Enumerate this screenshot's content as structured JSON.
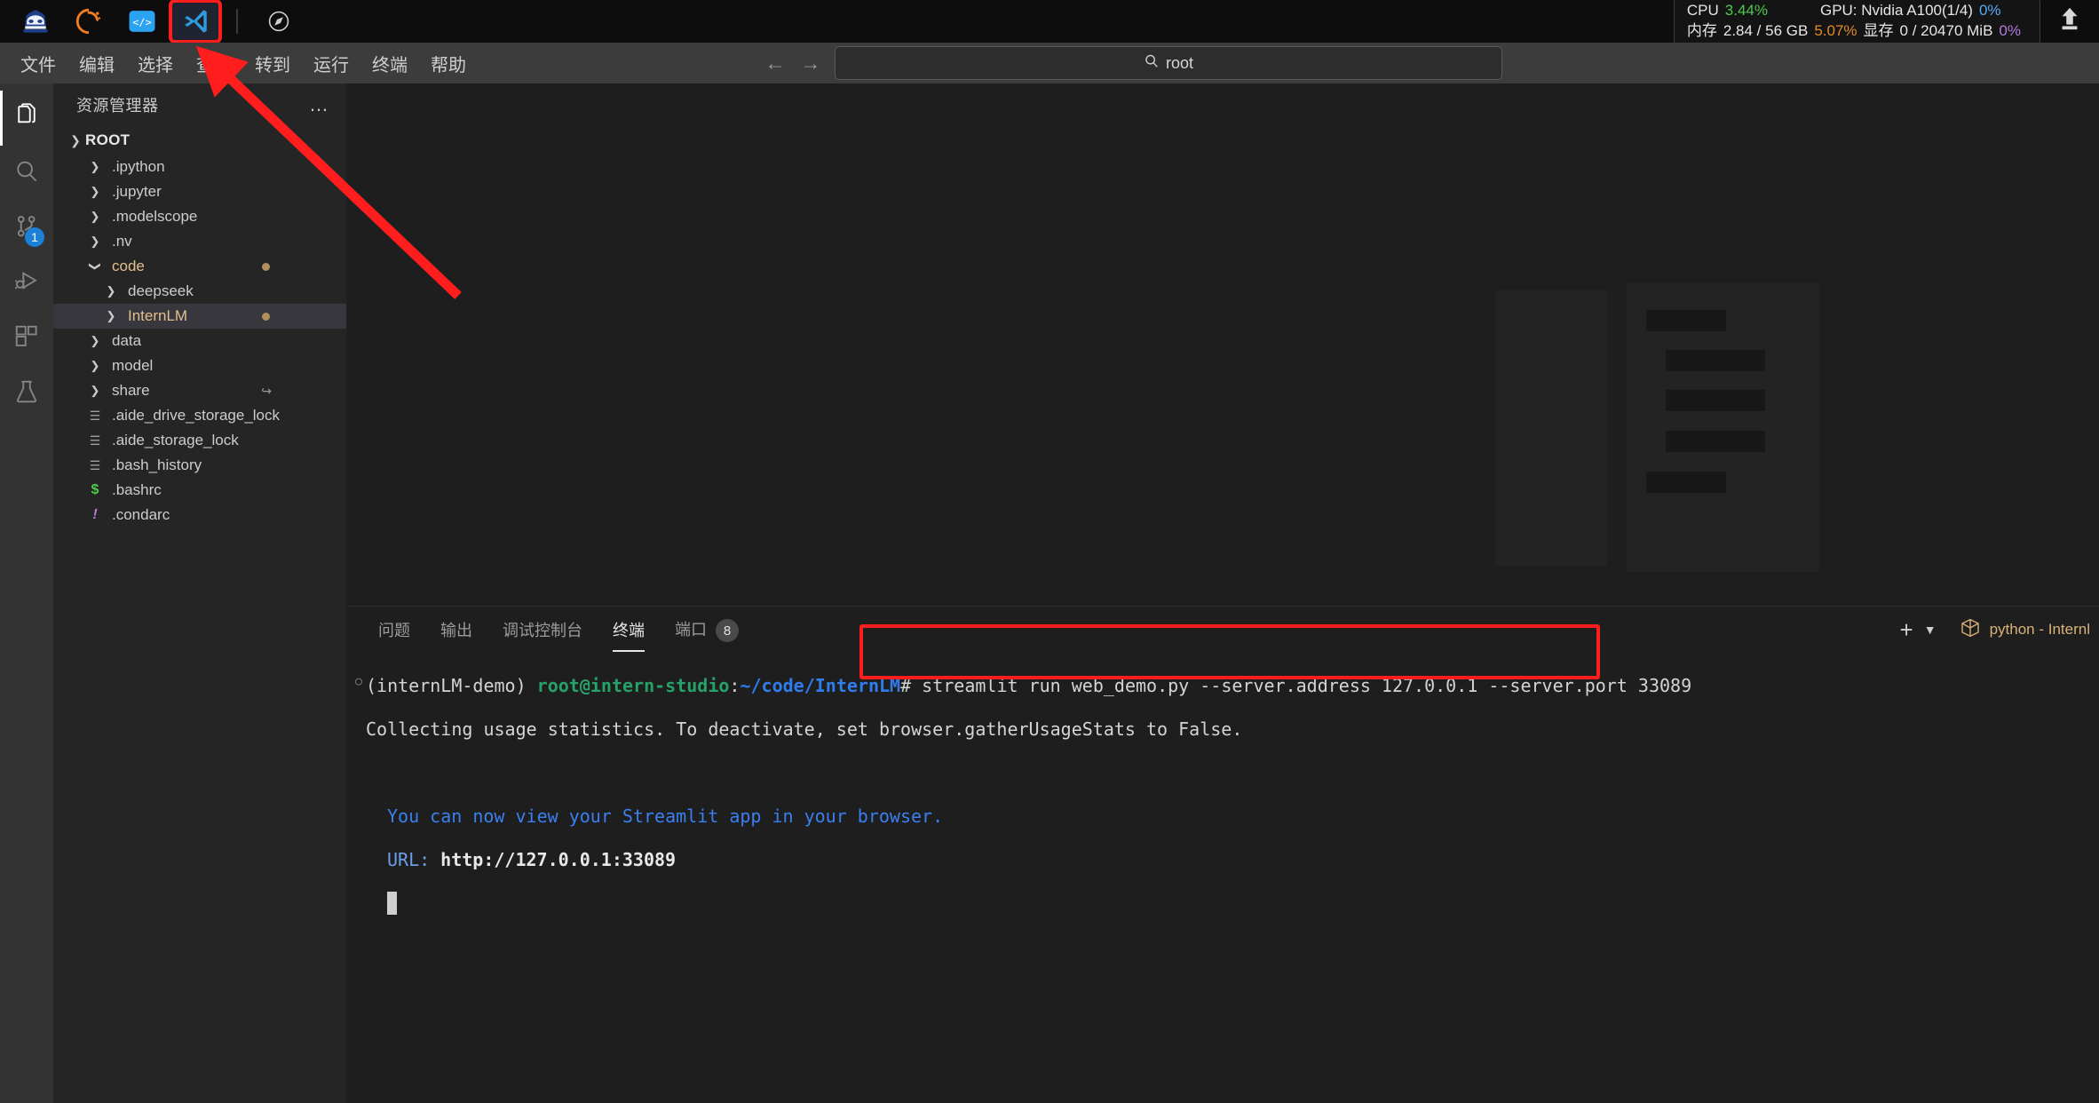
{
  "os_bar": {
    "icons": [
      {
        "name": "intern-studio-logo",
        "glyph": "mascot"
      },
      {
        "name": "conda-logo",
        "glyph": "conda"
      },
      {
        "name": "code-server-icon",
        "glyph": "<l>"
      },
      {
        "name": "vscode-icon",
        "glyph": "vscode",
        "highlighted": true
      },
      {
        "name": "compass-icon",
        "glyph": "compass"
      }
    ],
    "stats": {
      "cpu_label": "CPU",
      "cpu_value": "3.44%",
      "gpu_label": "GPU: Nvidia A100(1/4)",
      "gpu_value": "0%",
      "mem_label": "内存",
      "mem_value": "2.84 / 56 GB",
      "mem_percent": "5.07%",
      "vram_label": "显存",
      "vram_value": "0 / 20470 MiB",
      "vram_percent": "0%"
    },
    "upload_icon": "upload-icon"
  },
  "menubar": {
    "items": [
      "文件",
      "编辑",
      "选择",
      "查看",
      "转到",
      "运行",
      "终端",
      "帮助"
    ]
  },
  "search": {
    "back_icon": "←",
    "forward_icon": "→",
    "search_icon": "search-icon",
    "value": "root"
  },
  "activity_bar": {
    "items": [
      {
        "name": "explorer",
        "icon": "files-icon",
        "active": true,
        "badge": ""
      },
      {
        "name": "search",
        "icon": "search-icon",
        "active": false,
        "badge": ""
      },
      {
        "name": "source-control",
        "icon": "source-control-icon",
        "active": false,
        "badge": "1"
      },
      {
        "name": "run-and-debug",
        "icon": "run-debug-icon",
        "active": false,
        "badge": ""
      },
      {
        "name": "extensions",
        "icon": "extensions-icon",
        "active": false,
        "badge": ""
      },
      {
        "name": "testing",
        "icon": "beaker-icon",
        "active": false,
        "badge": ""
      }
    ]
  },
  "explorer": {
    "title": "资源管理器",
    "more_icon": "ellipsis-icon",
    "root_label": "ROOT",
    "tree": [
      {
        "label": ".ipython",
        "type": "folder",
        "depth": 1,
        "expanded": false,
        "selected": false,
        "modified": false
      },
      {
        "label": ".jupyter",
        "type": "folder",
        "depth": 1,
        "expanded": false,
        "selected": false,
        "modified": false
      },
      {
        "label": ".modelscope",
        "type": "folder",
        "depth": 1,
        "expanded": false,
        "selected": false,
        "modified": false
      },
      {
        "label": ".nv",
        "type": "folder",
        "depth": 1,
        "expanded": false,
        "selected": false,
        "modified": false
      },
      {
        "label": "code",
        "type": "folder",
        "depth": 1,
        "expanded": true,
        "selected": false,
        "modified": true
      },
      {
        "label": "deepseek",
        "type": "folder",
        "depth": 2,
        "expanded": false,
        "selected": false,
        "modified": false
      },
      {
        "label": "InternLM",
        "type": "folder",
        "depth": 2,
        "expanded": false,
        "selected": true,
        "modified": true
      },
      {
        "label": "data",
        "type": "folder",
        "depth": 1,
        "expanded": false,
        "selected": false,
        "modified": false
      },
      {
        "label": "model",
        "type": "folder",
        "depth": 1,
        "expanded": false,
        "selected": false,
        "modified": false
      },
      {
        "label": "share",
        "type": "folder",
        "depth": 1,
        "expanded": false,
        "selected": false,
        "modified": false,
        "symlink": true
      },
      {
        "label": ".aide_drive_storage_lock",
        "type": "file",
        "depth": 1,
        "icon": "text-file-icon"
      },
      {
        "label": ".aide_storage_lock",
        "type": "file",
        "depth": 1,
        "icon": "text-file-icon"
      },
      {
        "label": ".bash_history",
        "type": "file",
        "depth": 1,
        "icon": "text-file-icon"
      },
      {
        "label": ".bashrc",
        "type": "file",
        "depth": 1,
        "icon": "shell-file-icon"
      },
      {
        "label": ".condarc",
        "type": "file",
        "depth": 1,
        "icon": "config-file-icon"
      }
    ]
  },
  "panel": {
    "tabs": [
      {
        "label": "问题",
        "active": false,
        "count": ""
      },
      {
        "label": "输出",
        "active": false,
        "count": ""
      },
      {
        "label": "调试控制台",
        "active": false,
        "count": ""
      },
      {
        "label": "终端",
        "active": true,
        "count": ""
      },
      {
        "label": "端口",
        "active": false,
        "count": "8"
      }
    ],
    "new_terminal_icon": "plus-icon",
    "terminal_dropdown_icon": "chevron-down-icon",
    "terminal_instance_icon": "cube-icon",
    "terminal_instance_label": "python - Internl"
  },
  "terminal": {
    "prompt_env": "(internLM-demo) ",
    "prompt_user": "root@intern-studio",
    "prompt_colon": ":",
    "prompt_path": "~/code/InternLM",
    "prompt_sigil": "# ",
    "command": "streamlit run web_demo.py --server.address 127.0.0.1 --server.port 33089",
    "line_stats": "Collecting usage statistics. To deactivate, set browser.gatherUsageStats to False.",
    "line_view": "You can now view your Streamlit app in your browser.",
    "url_label": "URL:",
    "url_value": "http://127.0.0.1:33089"
  },
  "annotations": {
    "command_highlight_color": "#ff1d1d",
    "vscode_icon_highlight_color": "#ff1d1d",
    "arrow_color": "#ff1d1d"
  }
}
